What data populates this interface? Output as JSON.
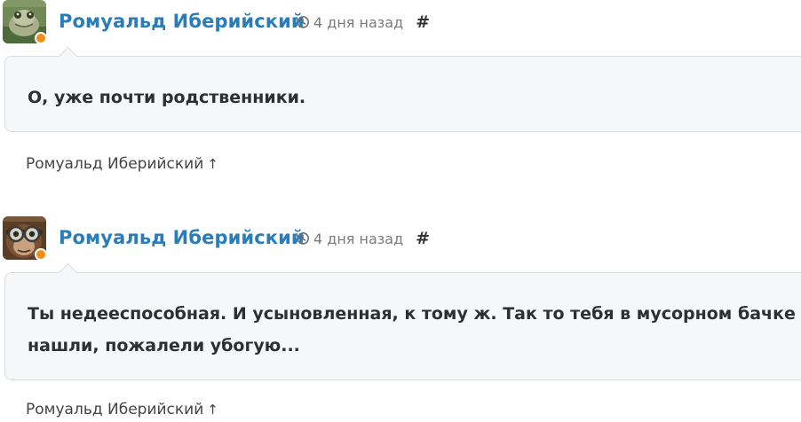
{
  "colors": {
    "author": "#2a7db8",
    "online": "#f28d18",
    "bubble_bg": "#f6f7f9",
    "bubble_border": "#dadde2",
    "time": "#7b7b7b"
  },
  "comments": [
    {
      "author": "Ромуальд Иберийский",
      "time": "4 дня назад",
      "permalink": "#",
      "text": "О, уже почти родственники.",
      "reply_to": "Ромуальд Иберийский",
      "reply_arrow": "↑",
      "avatar_icon": "frog-avatar",
      "time_icon": "history-icon"
    },
    {
      "author": "Ромуальд Иберийский",
      "time": "4 дня назад",
      "permalink": "#",
      "text": "Ты недееспособная. И усыновленная, к тому ж. Так то тебя в мусорном бачке нашли, пожалели убогую...",
      "reply_to": "Ромуальд Иберийский",
      "reply_arrow": "↑",
      "avatar_icon": "monkey-goggles-avatar",
      "time_icon": "history-icon"
    }
  ]
}
